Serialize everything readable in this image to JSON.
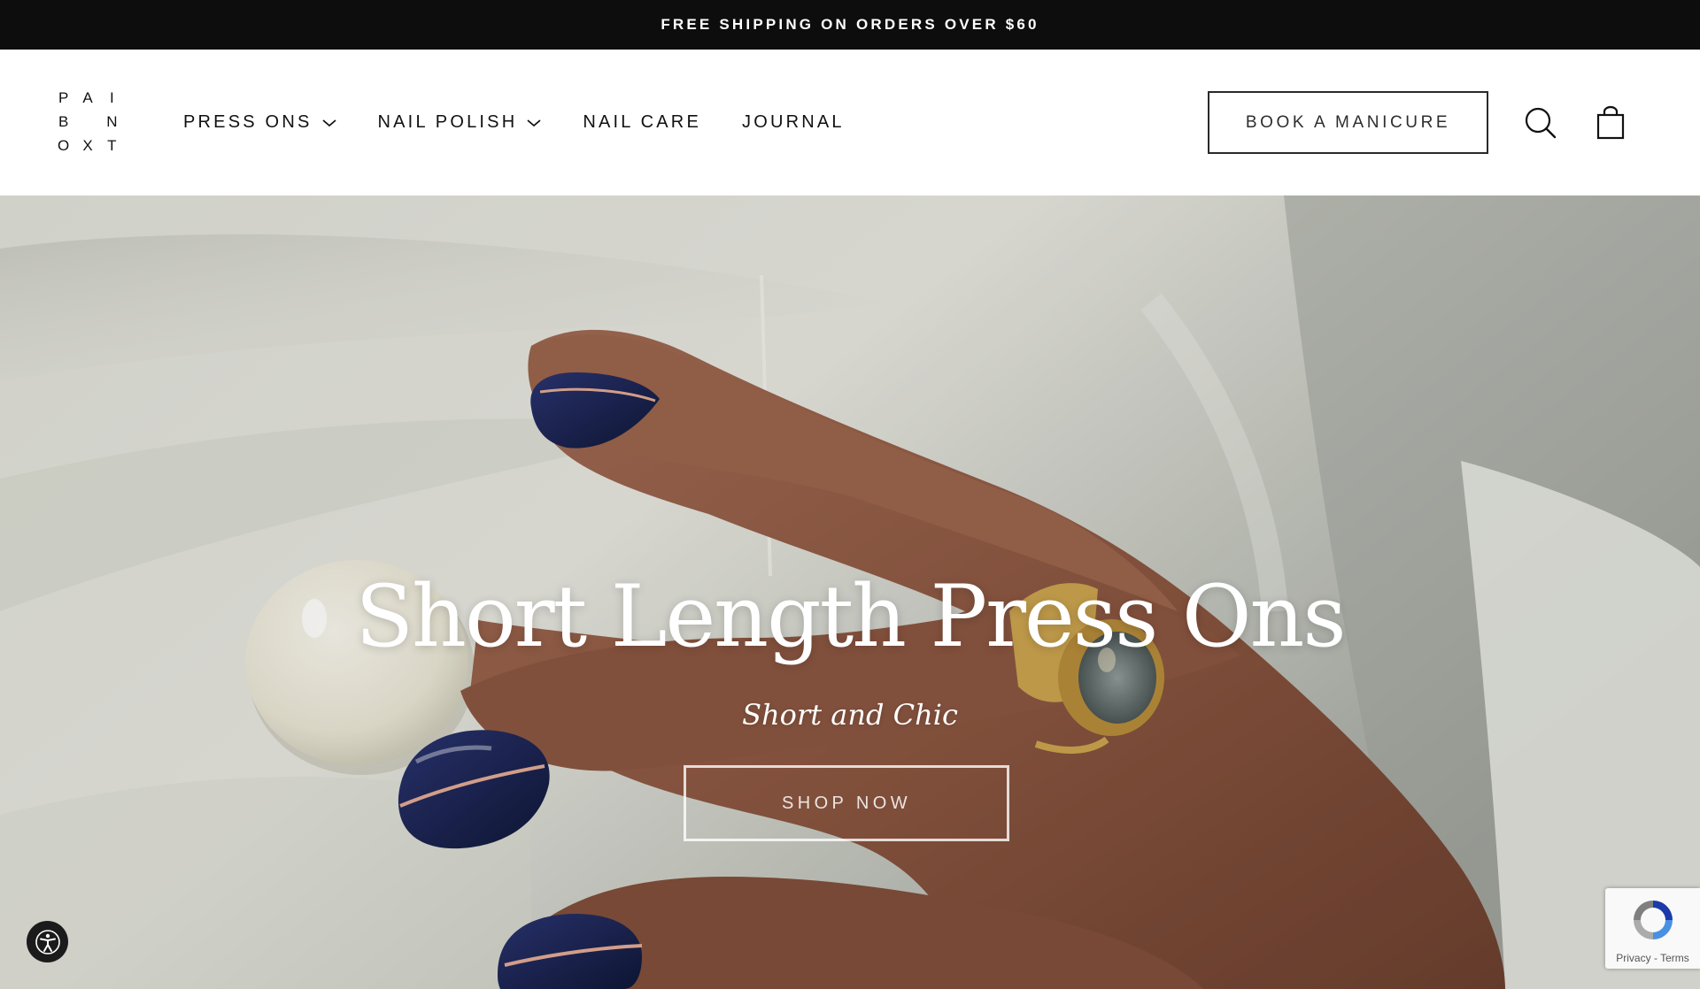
{
  "announcement": {
    "text": "FREE SHIPPING ON ORDERS OVER $60"
  },
  "header": {
    "logo_letters": [
      "P",
      "A",
      "I",
      "B",
      "",
      "N",
      "O",
      "X",
      "T"
    ],
    "nav": [
      {
        "label": "PRESS ONS",
        "has_dropdown": true
      },
      {
        "label": "NAIL POLISH",
        "has_dropdown": true
      },
      {
        "label": "NAIL CARE",
        "has_dropdown": false
      },
      {
        "label": "JOURNAL",
        "has_dropdown": false
      }
    ],
    "book_label": "BOOK A MANICURE",
    "icons": [
      "search-icon",
      "shopping-bag-icon"
    ]
  },
  "hero": {
    "title": "Short Length Press Ons",
    "subtitle": "Short and Chic",
    "cta_label": "SHOP NOW",
    "colors": {
      "fabric": "#dcdcd3",
      "skin": "#8a5640",
      "nail_polish": "#172046",
      "stripe": "#e0a892",
      "ring_gold": "#c9a24e"
    }
  },
  "widgets": {
    "accessibility_icon": "accessibility-icon",
    "recaptcha": {
      "privacy": "Privacy",
      "separator": " - ",
      "terms": "Terms"
    }
  }
}
